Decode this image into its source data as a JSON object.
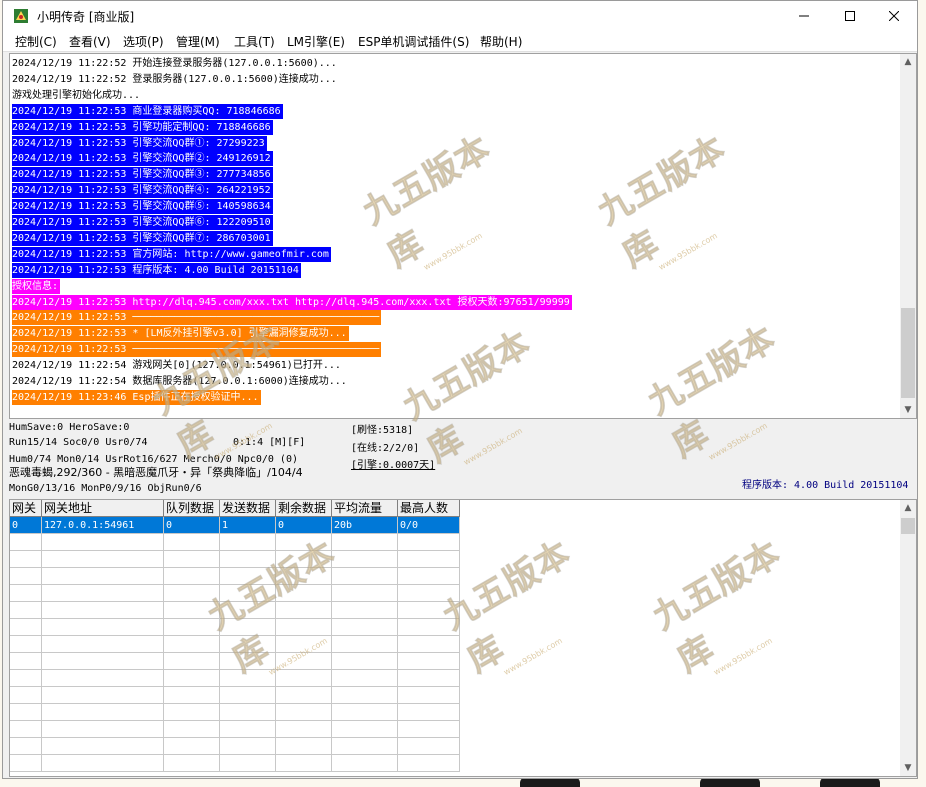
{
  "window": {
    "title": "小明传奇 [商业版]"
  },
  "menu": [
    "控制(C)",
    "查看(V)",
    "选项(P)",
    "管理(M)",
    "工具(T)",
    "LM引擎(E)",
    "ESP单机调试插件(S)",
    "帮助(H)"
  ],
  "log": [
    {
      "text": "2024/12/19 11:22:52 开始连接登录服务器(127.0.0.1:5600)...",
      "bg": "#ffffff",
      "fg": "#000000"
    },
    {
      "text": "2024/12/19 11:22:52 登录服务器(127.0.0.1:5600)连接成功...",
      "bg": "#ffffff",
      "fg": "#000000"
    },
    {
      "text": "游戏处理引擎初始化成功...",
      "bg": "#ffffff",
      "fg": "#000000"
    },
    {
      "text": "2024/12/19 11:22:53 商业登录器购买QQ: 718846686",
      "bg": "#0000ff",
      "fg": "#ffffff"
    },
    {
      "text": "2024/12/19 11:22:53 引擎功能定制QQ: 718846686",
      "bg": "#0000ff",
      "fg": "#ffffff"
    },
    {
      "text": "2024/12/19 11:22:53 引擎交流QQ群①: 27299223",
      "bg": "#0000ff",
      "fg": "#ffffff"
    },
    {
      "text": "2024/12/19 11:22:53 引擎交流QQ群②: 249126912",
      "bg": "#0000ff",
      "fg": "#ffffff"
    },
    {
      "text": "2024/12/19 11:22:53 引擎交流QQ群③: 277734856",
      "bg": "#0000ff",
      "fg": "#ffffff"
    },
    {
      "text": "2024/12/19 11:22:53 引擎交流QQ群④: 264221952",
      "bg": "#0000ff",
      "fg": "#ffffff"
    },
    {
      "text": "2024/12/19 11:22:53 引擎交流QQ群⑤: 140598634",
      "bg": "#0000ff",
      "fg": "#ffffff"
    },
    {
      "text": "2024/12/19 11:22:53 引擎交流QQ群⑥: 122209510",
      "bg": "#0000ff",
      "fg": "#ffffff"
    },
    {
      "text": "2024/12/19 11:22:53 引擎交流QQ群⑦: 286703001",
      "bg": "#0000ff",
      "fg": "#ffffff"
    },
    {
      "text": "2024/12/19 11:22:53 官方网站: http://www.gameofmir.com",
      "bg": "#0000ff",
      "fg": "#ffffff"
    },
    {
      "text": "2024/12/19 11:22:53 程序版本: 4.00 Build 20151104",
      "bg": "#0000ff",
      "fg": "#ffffff"
    },
    {
      "text": "授权信息:",
      "bg": "#ff00ff",
      "fg": "#ffffff"
    },
    {
      "text": "2024/12/19 11:22:53 http://dlq.945.com/xxx.txt http://dlq.945.com/xxx.txt 授权天数:97651/99999",
      "bg": "#ff00ff",
      "fg": "#ffffff"
    },
    {
      "text": "2024/12/19 11:22:53 ─────────────────────────────────────────",
      "bg": "#ff7f00",
      "fg": "#ffffff"
    },
    {
      "text": "2024/12/19 11:22:53 * [LM反外挂引擎v3.0] 引擎漏洞修复成功...",
      "bg": "#ff7f00",
      "fg": "#ffffff"
    },
    {
      "text": "2024/12/19 11:22:53 ─────────────────────────────────────────",
      "bg": "#ff7f00",
      "fg": "#ffffff"
    },
    {
      "text": "2024/12/19 11:22:54 游戏网关[0](127.0.0.1:54961)已打开...",
      "bg": "#ffffff",
      "fg": "#000000"
    },
    {
      "text": "2024/12/19 11:22:54 数据库服务器(127.0.0.1:6000)连接成功...",
      "bg": "#ffffff",
      "fg": "#000000"
    },
    {
      "text": "2024/12/19 11:23:46 Esp插件正在授权验证中...",
      "bg": "#ff7f00",
      "fg": "#ffffff"
    }
  ],
  "status": {
    "line1": "HumSave:0 HeroSave:0",
    "line2a": "Run15/14 Soc0/0 Usr0/74",
    "line2b": "0:1:4 [M][F]",
    "line3": "Hum0/74 Mon0/14 UsrRot16/627 Merch0/0 Npc0/0 (0)",
    "line4": "恶魂毒蝎,292/360 - 黑暗恶魔爪牙・异「祭典降临」/104/4",
    "line5": "MonG0/13/16 MonP0/9/16 ObjRun0/6",
    "refresh_monster": "[刷怪:5318]",
    "online": "[在线:2/2/0]",
    "engine": "[引擎:0.0007天]",
    "version": "程序版本: 4.00 Build 20151104"
  },
  "grid": {
    "columns": [
      "网关",
      "网关地址",
      "队列数据",
      "发送数据",
      "剩余数据",
      "平均流量",
      "最高人数"
    ],
    "rows": [
      [
        "0",
        "127.0.0.1:54961",
        "0",
        "1",
        "0",
        "20b",
        "0/0"
      ]
    ]
  },
  "watermark": {
    "text": "九五版本库",
    "sub": "www.95bbk.com"
  },
  "colors": {
    "log_blue": "#0000ff",
    "log_magenta": "#ff00ff",
    "log_orange": "#ff7f00",
    "selection": "#0078d7",
    "version_text": "#000080"
  },
  "icons": {
    "app": "app-logo-icon",
    "minimize": "minimize-icon",
    "maximize": "maximize-icon",
    "close": "close-icon"
  }
}
